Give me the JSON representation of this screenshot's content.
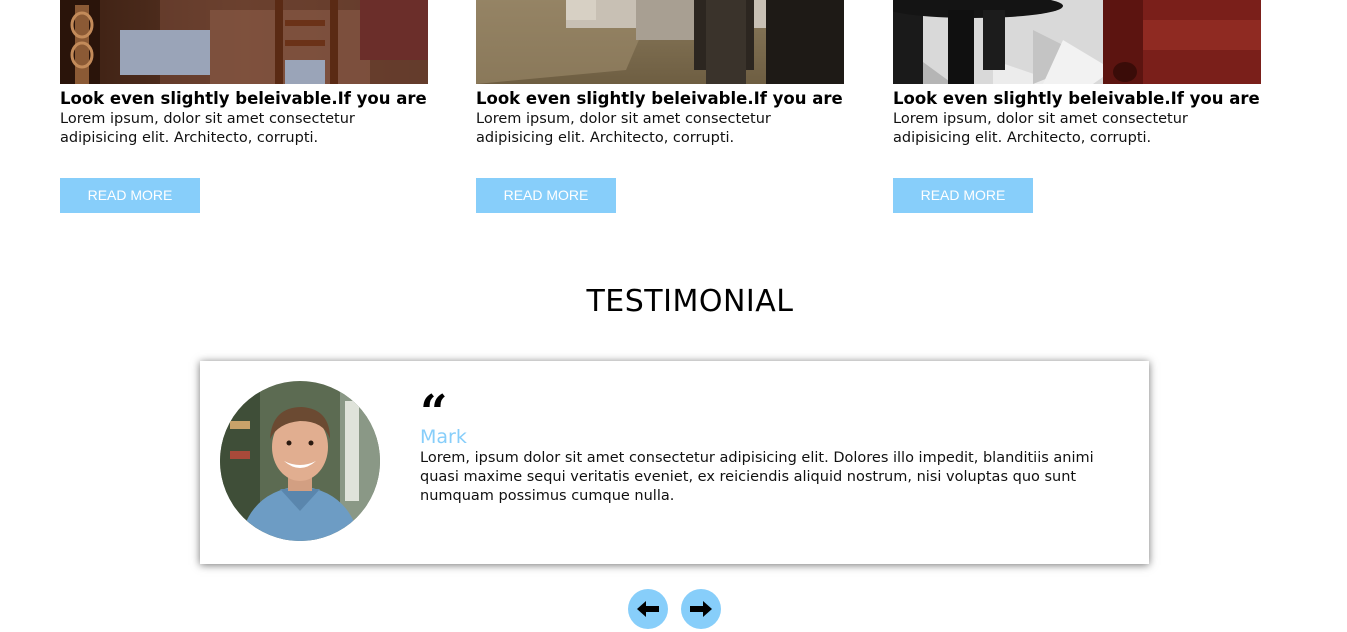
{
  "cards": [
    {
      "title": "Look even slightly beleivable.If you are",
      "text": "Lorem ipsum, dolor sit amet consectetur adipisicing elit. Architecto, corrupti.",
      "button": "READ MORE"
    },
    {
      "title": "Look even slightly beleivable.If you are",
      "text": "Lorem ipsum, dolor sit amet consectetur adipisicing elit. Architecto, corrupti.",
      "button": "READ MORE"
    },
    {
      "title": "Look even slightly beleivable.If you are",
      "text": "Lorem ipsum, dolor sit amet consectetur adipisicing elit. Architecto, corrupti.",
      "button": "READ MORE"
    }
  ],
  "testimonial": {
    "heading": "TESTIMONIAL",
    "quote_mark": "“",
    "name": "Mark",
    "text": "Lorem, ipsum dolor sit amet consectetur adipisicing elit. Dolores illo impedit, blanditiis animi quasi maxime sequi veritatis eveniet, ex reiciendis aliquid nostrum, nisi voluptas quo sunt numquam possimus cumque nulla."
  },
  "navigation": {
    "prev_icon": "arrow-left-icon",
    "next_icon": "arrow-right-icon"
  },
  "colors": {
    "accent": "#87cefa",
    "text": "#000000"
  }
}
